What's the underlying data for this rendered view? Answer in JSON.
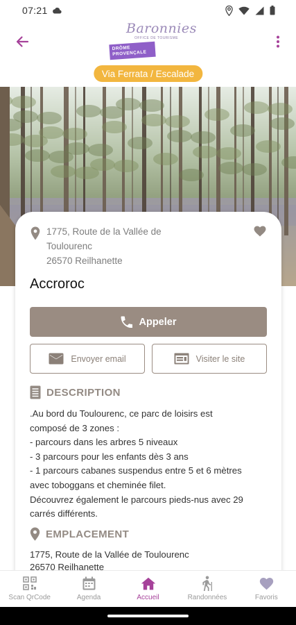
{
  "status_bar": {
    "time": "07:21",
    "icons": [
      "cloud-icon",
      "location-icon",
      "wifi-icon",
      "signal-icon",
      "battery-icon"
    ]
  },
  "app_bar": {
    "logo": {
      "script_text": "Baronnies",
      "tagline": "OFFICE DE TOURISME",
      "badge_line1": "DRÔME",
      "badge_line2": "PROVENÇALE"
    },
    "category": "Via Ferrata / Escalade",
    "icons": [
      "back-arrow-icon",
      "more-vertical-icon"
    ]
  },
  "listing": {
    "address_lines": [
      "1775, Route de la Vallée de",
      "Toulourenc",
      "26570 Reilhanette"
    ],
    "title": "Accroroc",
    "call_label": "Appeler",
    "email_label": "Envoyer email",
    "site_label": "Visiter le site",
    "description_heading": "DESCRIPTION",
    "description_lines": [
      ".Au bord du Toulourenc, ce parc de loisirs est",
      "composé de 3 zones :",
      "- parcours dans les arbres 5 niveaux",
      "- 3 parcours pour les enfants dès 3 ans",
      "- 1 parcours cabanes suspendus entre 5 et 6 mètres",
      "avec toboggans et cheminée filet.",
      "Découvrez également le parcours pieds-nus avec 29",
      "carrés différents."
    ],
    "location_heading": "EMPLACEMENT",
    "location_lines": [
      "1775, Route de la Vallée de Toulourenc",
      "26570  Reilhanette"
    ]
  },
  "bottom_nav": {
    "items": [
      {
        "label": "Scan QrCode",
        "icon": "qr-code-icon",
        "active": false
      },
      {
        "label": "Agenda",
        "icon": "calendar-icon",
        "active": false
      },
      {
        "label": "Accueil",
        "icon": "home-icon",
        "active": true
      },
      {
        "label": "Randonnées",
        "icon": "hiker-icon",
        "active": false
      },
      {
        "label": "Favoris",
        "icon": "heart-icon",
        "active": false
      }
    ]
  },
  "colors": {
    "accent": "#a6429a",
    "category_pill": "#f2b63f",
    "button": "#9a8c82",
    "section_heading": "#938a83"
  }
}
